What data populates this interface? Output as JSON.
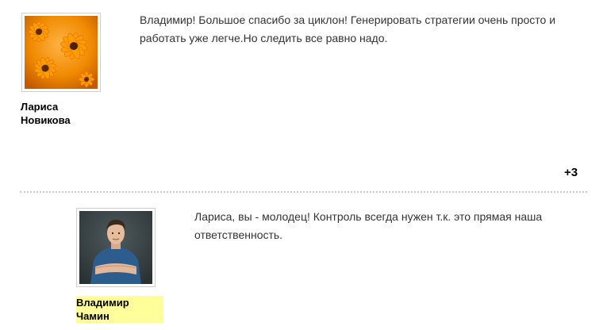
{
  "comments": [
    {
      "author_line1": "Лариса",
      "author_line2": "Новикова",
      "text": "Владимир! Большое спасибо за циклон! Генерировать стратегии очень просто и работать уже легче.Но следить все равно надо.",
      "rating": "+3",
      "avatar_icon": "orange-flowers-photo"
    },
    {
      "author_line1": "Владимир",
      "author_line2": "Чамин",
      "text": "Лариса, вы - молодец! Контроль всегда нужен т.к. это прямая наша ответственность.",
      "author_highlight_color": "#ffff99",
      "avatar_icon": "man-portrait-photo"
    }
  ]
}
